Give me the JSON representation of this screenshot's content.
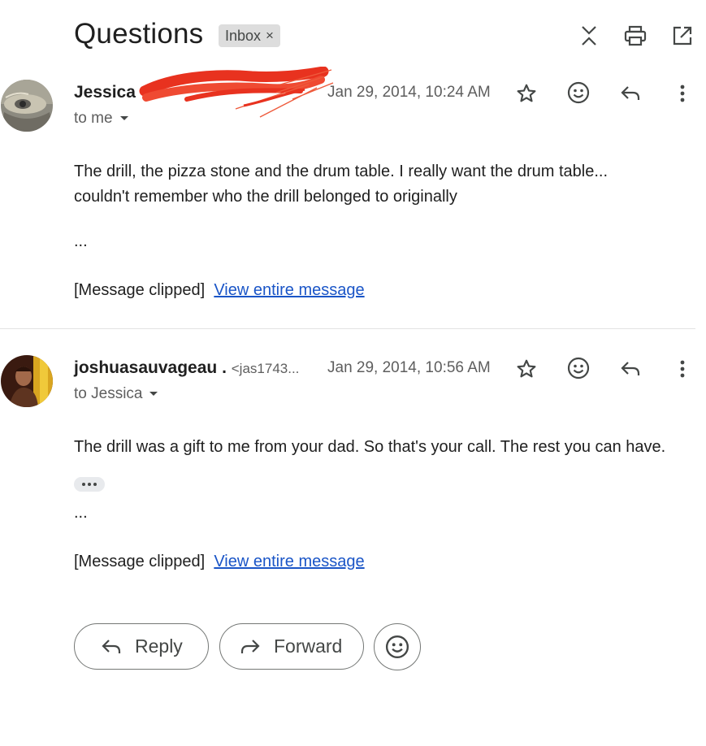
{
  "thread": {
    "subject": "Questions",
    "label": "Inbox",
    "label_remove": "×"
  },
  "header_icons": [
    "collapse-all-icon",
    "print-icon",
    "open-in-new-window-icon"
  ],
  "messages": [
    {
      "sender": "Jessica",
      "sender_email": "",
      "date": "Jan 29, 2014, 10:24 AM",
      "to": "to me",
      "body_lines": [
        "The drill, the pizza stone and the drum table.  I really want the drum table...",
        "couldn't remember who the drill belonged to originally"
      ],
      "ellipsis": "...",
      "clipped_text": "[Message clipped]",
      "view_link": "View entire message"
    },
    {
      "sender": "joshuasauvageau .",
      "sender_email": "<jas1743...",
      "date": "Jan 29, 2014, 10:56 AM",
      "to": "to Jessica",
      "body_lines": [
        "The drill was a gift to me from your dad. So that's your call. The rest you can have."
      ],
      "ellipsis": "...",
      "clipped_text": "[Message clipped]",
      "view_link": "View entire message"
    }
  ],
  "actions": {
    "reply": "Reply",
    "forward": "Forward"
  },
  "colors": {
    "link": "#1a55c7",
    "redaction": "#e8321f",
    "chip_bg": "#dddddd"
  }
}
